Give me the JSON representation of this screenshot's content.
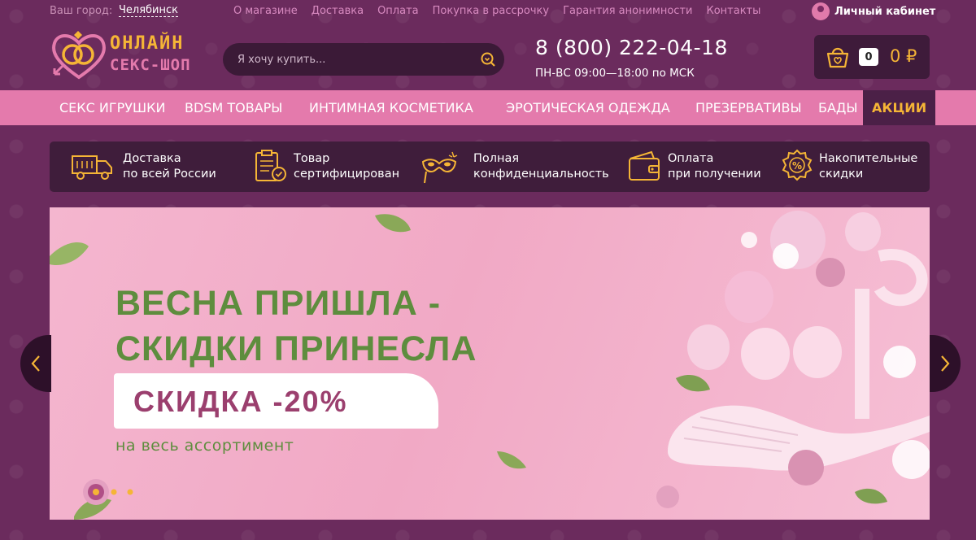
{
  "topbar": {
    "city_label": "Ваш город:",
    "city_value": "Челябинск",
    "links": [
      "О магазине",
      "Доставка",
      "Оплата",
      "Покупка в рассрочку",
      "Гарантия анонимности",
      "Контакты"
    ],
    "cabinet_label": "Личный кабинет"
  },
  "logo": {
    "line1": "ОНЛАЙН",
    "line2": "СЕКС-ШОП"
  },
  "search": {
    "placeholder": "Я хочу купить..."
  },
  "contact": {
    "phone": "8 (800) 222-04-18",
    "hours": "ПН-ВС 09:00—18:00 по МСК"
  },
  "cart": {
    "count": "0",
    "sum": "0 ₽"
  },
  "nav": {
    "items": [
      "СЕКС ИГРУШКИ",
      "BDSM ТОВАРЫ",
      "ИНТИМНАЯ КОСМЕТИКА",
      "ЭРОТИЧЕСКАЯ ОДЕЖДА",
      "ПРЕЗЕРВАТИВЫ",
      "БАДЫ"
    ],
    "active": "АКЦИИ"
  },
  "advantages": [
    {
      "icon": "truck-icon",
      "line1": "Доставка",
      "line2": "по всей России"
    },
    {
      "icon": "certificate-icon",
      "line1": "Товар",
      "line2": "сертифицирован"
    },
    {
      "icon": "mask-icon",
      "line1": "Полная",
      "line2": "конфиденциальность"
    },
    {
      "icon": "wallet-icon",
      "line1": "Оплата",
      "line2": "при получении"
    },
    {
      "icon": "discount-icon",
      "line1": "Накопительные",
      "line2": "скидки"
    }
  ],
  "banner": {
    "title_line1": "ВЕСНА ПРИШЛА -",
    "title_line2": "СКИДКИ ПРИНЕСЛА",
    "badge": "СКИДКА -20%",
    "subtitle": "на весь ассортимент",
    "slides_count": 3,
    "active_slide": 1
  },
  "colors": {
    "background": "#6b2b5d",
    "accent_pink": "#e47aac",
    "accent_gold": "#f5b536",
    "dark_panel": "#3f1d3b",
    "banner_green": "#5e8d3e",
    "badge_text": "#9b3f6e"
  }
}
